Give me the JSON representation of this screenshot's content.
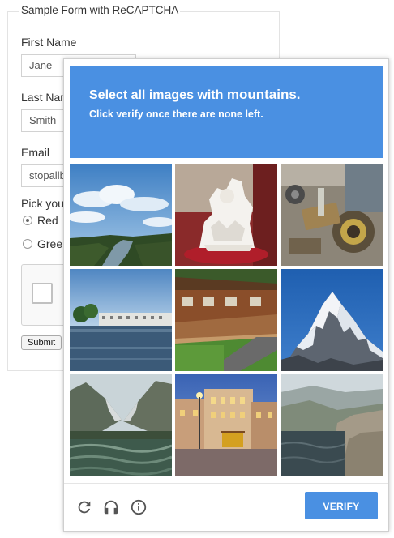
{
  "form": {
    "legend": "Sample Form with ReCAPTCHA",
    "first_name_label": "First Name",
    "first_name_value": "Jane",
    "last_name_label": "Last Nar",
    "last_name_value": "Smith",
    "email_label": "Email",
    "email_value": "stopallb",
    "pick_label": "Pick you",
    "radio_options": [
      {
        "label": "Red",
        "checked": true
      },
      {
        "label": "Greer",
        "checked": false
      }
    ],
    "submit_label": "Submit"
  },
  "challenge": {
    "accent_color": "#4a90e2",
    "instruction_prefix": "Select all images with ",
    "instruction_target": "mountains.",
    "instruction_sub": "Click verify once there are none left.",
    "tiles": [
      {
        "subject": "sky-clouds-river"
      },
      {
        "subject": "white-ceramic-figurine"
      },
      {
        "subject": "scrap-machinery"
      },
      {
        "subject": "lake-city-waterfront"
      },
      {
        "subject": "wooden-cabin-lawn"
      },
      {
        "subject": "snowy-mountain-peak"
      },
      {
        "subject": "mountain-valley-lake"
      },
      {
        "subject": "city-square-night"
      },
      {
        "subject": "coastal-cliffs"
      }
    ],
    "footer": {
      "reload_icon": "reload-icon",
      "audio_icon": "headphones-icon",
      "info_icon": "info-icon",
      "verify_label": "VERIFY"
    }
  }
}
